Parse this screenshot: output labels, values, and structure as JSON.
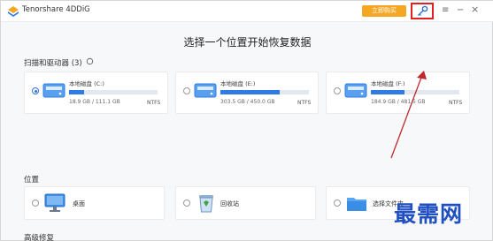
{
  "window": {
    "title": "Tenorshare 4DDiG",
    "buy_label": "立即购买",
    "icons": [
      "4ddig-logo-icon",
      "key-icon",
      "menu-icon",
      "minimize-icon",
      "close-icon"
    ]
  },
  "heading": "选择一个位置开始恢复数据",
  "drives_section": {
    "label": "扫描和驱动器 (3)",
    "drives": [
      {
        "name": "本地磁盘 (C:)",
        "size": "18.9 GB / 111.1 GB",
        "fs": "NTFS",
        "usage_fraction": 0.17,
        "selected": true
      },
      {
        "name": "本地磁盘 (E:)",
        "size": "303.5 GB / 450.0 GB",
        "fs": "NTFS",
        "usage_fraction": 0.67,
        "selected": false
      },
      {
        "name": "本地磁盘 (F:)",
        "size": "184.9 GB / 481.5 GB",
        "fs": "NTFS",
        "usage_fraction": 0.38,
        "selected": false
      }
    ]
  },
  "locations_section": {
    "label": "位置",
    "items": [
      {
        "label": "桌面",
        "icon": "desktop-icon"
      },
      {
        "label": "回收站",
        "icon": "recycle-bin-icon"
      },
      {
        "label": "选择文件夹",
        "icon": "folder-icon"
      }
    ]
  },
  "advanced_section": {
    "label": "高级修复"
  },
  "watermark": "最需网",
  "colors": {
    "accent": "#2f7be6",
    "buy": "#f5a623",
    "highlight_box": "#e32020",
    "arrow": "#c0282d"
  }
}
